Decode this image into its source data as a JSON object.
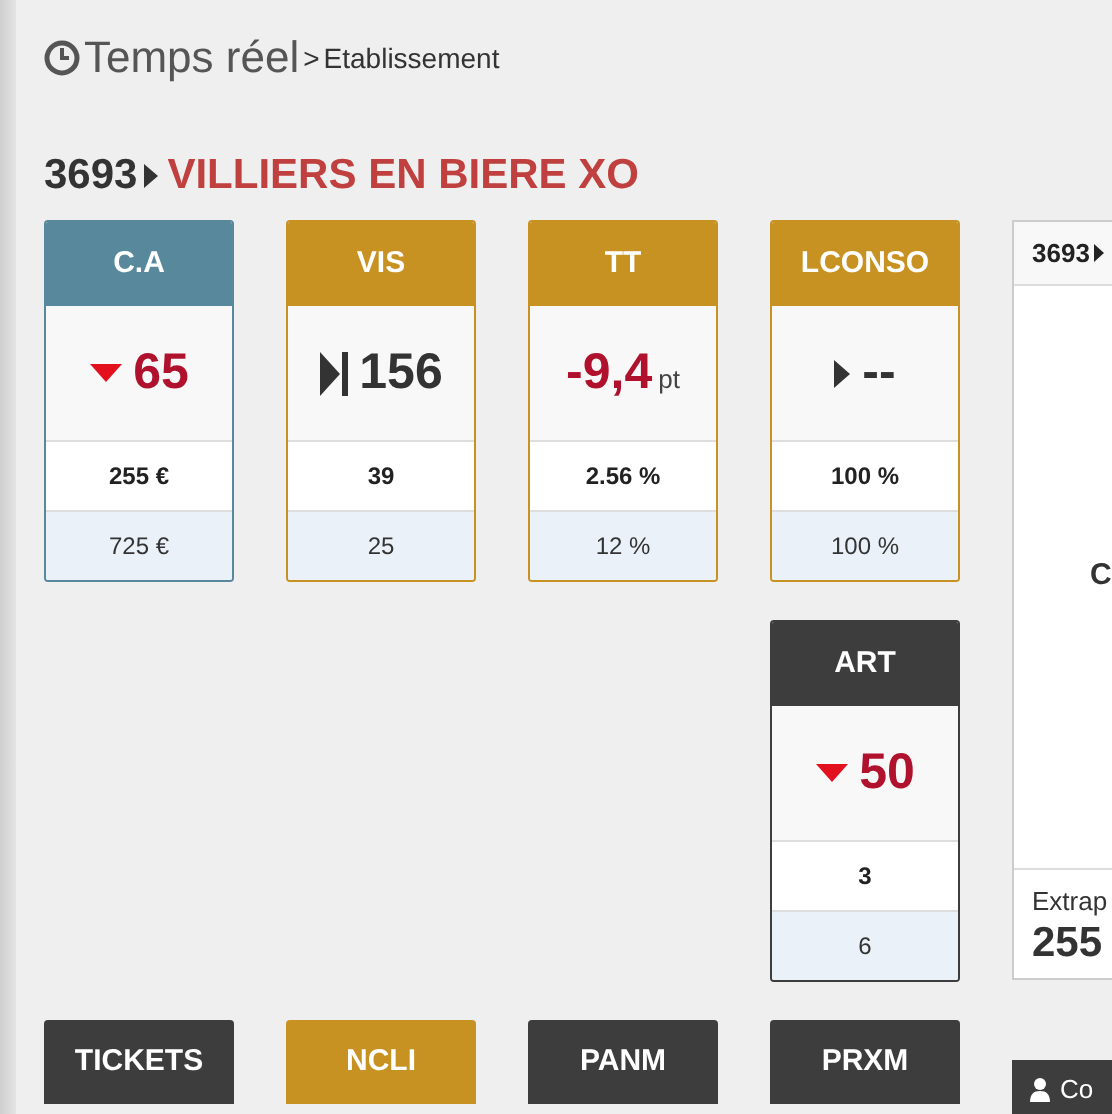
{
  "breadcrumb": {
    "title": "Temps réel",
    "separator": ">",
    "page": "Etablissement"
  },
  "store": {
    "code": "3693",
    "name": "VILLIERS EN BIERE XO"
  },
  "cards_row_1": [
    {
      "label": "C.A",
      "color": "#57889c",
      "trend": {
        "kind": "down"
      },
      "value": "65",
      "negative": true,
      "row_1": "255 €",
      "row_2": "725 €"
    },
    {
      "label": "VIS",
      "color": "#c89222",
      "trend": {
        "kind": "skip"
      },
      "value": "156",
      "negative": false,
      "row_1": "39",
      "row_2": "25"
    },
    {
      "label": "TT",
      "color": "#c89222",
      "value": "-9,4",
      "unit": "pt",
      "negative": true,
      "row_1": "2.56 %",
      "row_2": "12 %"
    },
    {
      "label": "LCONSO",
      "color": "#c89222",
      "trend": {
        "kind": "right"
      },
      "value": "--",
      "negative": false,
      "row_1": "100 %",
      "row_2": "100 %"
    }
  ],
  "cards_row_2": [
    {
      "label": "ART",
      "color": "#3d3d3d",
      "trend": {
        "kind": "down"
      },
      "value": "50",
      "negative": true,
      "row_1": "3",
      "row_2": "6"
    }
  ],
  "cards_row_3": [
    {
      "label": "TICKETS",
      "color": "#3d3d3d"
    },
    {
      "label": "NCLI",
      "color": "#c89222"
    },
    {
      "label": "PANM",
      "color": "#3d3d3d"
    },
    {
      "label": "PRXM",
      "color": "#3d3d3d"
    }
  ],
  "side_panel": {
    "header": "3693",
    "center": "C",
    "footer_label": "Extrap",
    "footer_value": "255"
  },
  "side_bar": {
    "label": "Co"
  }
}
